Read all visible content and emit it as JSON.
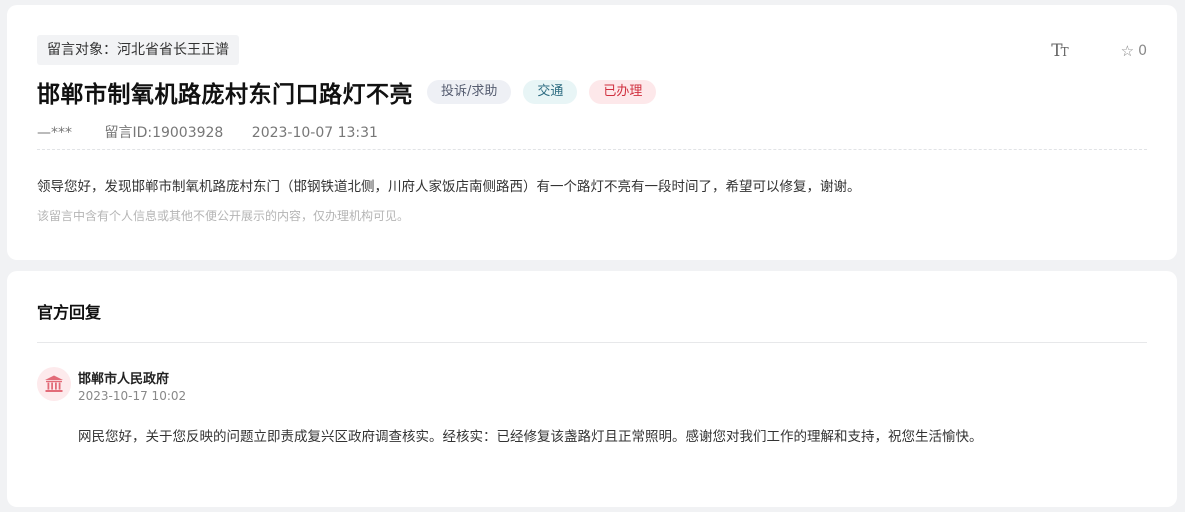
{
  "message": {
    "target_label": "留言对象：河北省省长王正谱",
    "title": "邯郸市制氧机路庞村东门口路灯不亮",
    "badges": {
      "type": "投诉/求助",
      "domain": "交通",
      "status": "已办理"
    },
    "author": "—***",
    "message_id": "留言ID:19003928",
    "datetime": "2023-10-07 13:31",
    "content": "领导您好，发现邯郸市制氧机路庞村东门（邯钢铁道北侧，川府人家饭店南侧路西）有一个路灯不亮有一段时间了，希望可以修复，谢谢。",
    "privacy_note": "该留言中含有个人信息或其他不便公开展示的内容，仅办理机构可见。"
  },
  "tools": {
    "font_size_icon": "Tт",
    "favorite_count": "0"
  },
  "reply": {
    "heading": "官方回复",
    "org_name": "邯郸市人民政府",
    "datetime": "2023-10-17 10:02",
    "content": "网民您好，关于您反映的问题立即责成复兴区政府调查核实。经核实：已经修复该盏路灯且正常照明。感谢您对我们工作的理解和支持，祝您生活愉快。"
  },
  "colors": {
    "status_red": "#d0303f",
    "domain_teal": "#2f6d82",
    "avatar_icon": "#e26b78"
  },
  "icons": {
    "font_size": "font-size-icon",
    "favorite": "star-icon",
    "org": "government-building-icon"
  }
}
